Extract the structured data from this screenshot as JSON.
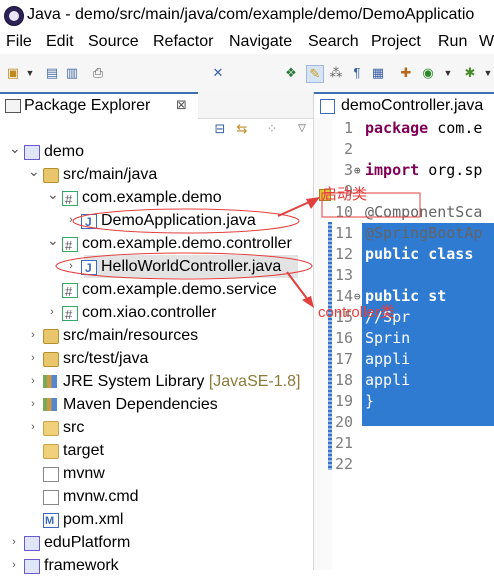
{
  "window": {
    "title": "Java - demo/src/main/java/com/example/demo/DemoApplicatio"
  },
  "menu": [
    "File",
    "Edit",
    "Source",
    "Refactor",
    "Navigate",
    "Search",
    "Project",
    "Run",
    "W"
  ],
  "toolbar_icons": [
    "new-icon",
    "save-icon",
    "save-all-icon",
    "print-icon",
    "skip-breakpoints-icon",
    "open-type-icon",
    "mark-occurrences-icon",
    "toggle-icon",
    "show-whitespace-icon",
    "block-selection-icon",
    "build-icon",
    "run-icon",
    "debug-icon"
  ],
  "package_explorer": {
    "tab_label": "Package Explorer",
    "close_glyph": "⊠",
    "tree": [
      {
        "label": "demo",
        "icon": "project-icon",
        "arrow": "v",
        "indent": 0
      },
      {
        "label": "src/main/java",
        "icon": "source-folder-icon",
        "arrow": "v",
        "indent": 1
      },
      {
        "label": "com.example.demo",
        "icon": "package-icon",
        "arrow": "v",
        "indent": 2
      },
      {
        "label": "DemoApplication.java",
        "icon": "java-file-icon",
        "arrow": ">",
        "indent": 3
      },
      {
        "label": "com.example.demo.controller",
        "icon": "package-icon",
        "arrow": "v",
        "indent": 2
      },
      {
        "label": "HelloWorldController.java",
        "icon": "java-file-icon",
        "arrow": ">",
        "indent": 3,
        "selected": true
      },
      {
        "label": "com.example.demo.service",
        "icon": "package-icon",
        "arrow": "",
        "indent": 2
      },
      {
        "label": "com.xiao.controller",
        "icon": "package-icon",
        "arrow": ">",
        "indent": 2
      },
      {
        "label": "src/main/resources",
        "icon": "source-folder-icon",
        "arrow": ">",
        "indent": 1
      },
      {
        "label": "src/test/java",
        "icon": "source-folder-icon",
        "arrow": ">",
        "indent": 1
      },
      {
        "label": "JRE System Library",
        "decor": "[JavaSE-1.8]",
        "icon": "library-icon",
        "arrow": ">",
        "indent": 1
      },
      {
        "label": "Maven Dependencies",
        "icon": "library-icon",
        "arrow": ">",
        "indent": 1
      },
      {
        "label": "src",
        "icon": "folder-icon",
        "arrow": ">",
        "indent": 1
      },
      {
        "label": "target",
        "icon": "folder-icon",
        "arrow": "",
        "indent": 1
      },
      {
        "label": "mvnw",
        "icon": "file-icon",
        "arrow": "",
        "indent": 1
      },
      {
        "label": "mvnw.cmd",
        "icon": "file-icon",
        "arrow": "",
        "indent": 1
      },
      {
        "label": "pom.xml",
        "icon": "xml-file-icon",
        "arrow": "",
        "indent": 1
      },
      {
        "label": "eduPlatform",
        "icon": "project-icon",
        "arrow": ">",
        "indent": 0
      },
      {
        "label": "framework",
        "icon": "project-icon",
        "arrow": ">",
        "indent": 0
      }
    ]
  },
  "editor": {
    "tab_label": "demoController.java",
    "lines": [
      {
        "n": "1",
        "parts": [
          {
            "t": "package",
            "c": "kw"
          },
          {
            "t": " com.e"
          }
        ]
      },
      {
        "n": "2",
        "parts": []
      },
      {
        "n": "3⊕",
        "parts": [
          {
            "t": "import",
            "c": "kw"
          },
          {
            "t": " org.sp"
          }
        ]
      },
      {
        "n": "9",
        "parts": []
      },
      {
        "n": "10",
        "parts": [
          {
            "t": "@ComponentSca",
            "c": "ann"
          }
        ]
      },
      {
        "n": "11",
        "parts": [
          {
            "t": "@SpringBootAp",
            "c": "ann"
          }
        ],
        "selected": true
      },
      {
        "n": "12",
        "parts": [
          {
            "t": "public class",
            "c": "kw"
          }
        ],
        "selected": true
      },
      {
        "n": "13",
        "parts": [],
        "selected": true
      },
      {
        "n": "14⊖",
        "parts": [
          {
            "t": "    "
          },
          {
            "t": "public st",
            "c": "kw"
          }
        ],
        "selected": true
      },
      {
        "n": "15",
        "parts": [
          {
            "t": "      //Spr"
          }
        ],
        "selected": true
      },
      {
        "n": "16",
        "parts": [
          {
            "t": "      Sprin"
          }
        ],
        "selected": true
      },
      {
        "n": "17",
        "parts": [
          {
            "t": "      appli"
          }
        ],
        "selected": true
      },
      {
        "n": "18",
        "parts": [
          {
            "t": "      appli"
          }
        ],
        "selected": true
      },
      {
        "n": "19",
        "parts": [
          {
            "t": "    }"
          }
        ],
        "selected": true
      },
      {
        "n": "20",
        "parts": [],
        "selected": true
      },
      {
        "n": "21",
        "parts": [
          {
            "t": "}"
          }
        ],
        "selected": true
      },
      {
        "n": "22",
        "parts": []
      }
    ]
  },
  "annotations": {
    "startup_label": "启动类",
    "controller_label": "controller类",
    "color": "#e43f3f"
  }
}
